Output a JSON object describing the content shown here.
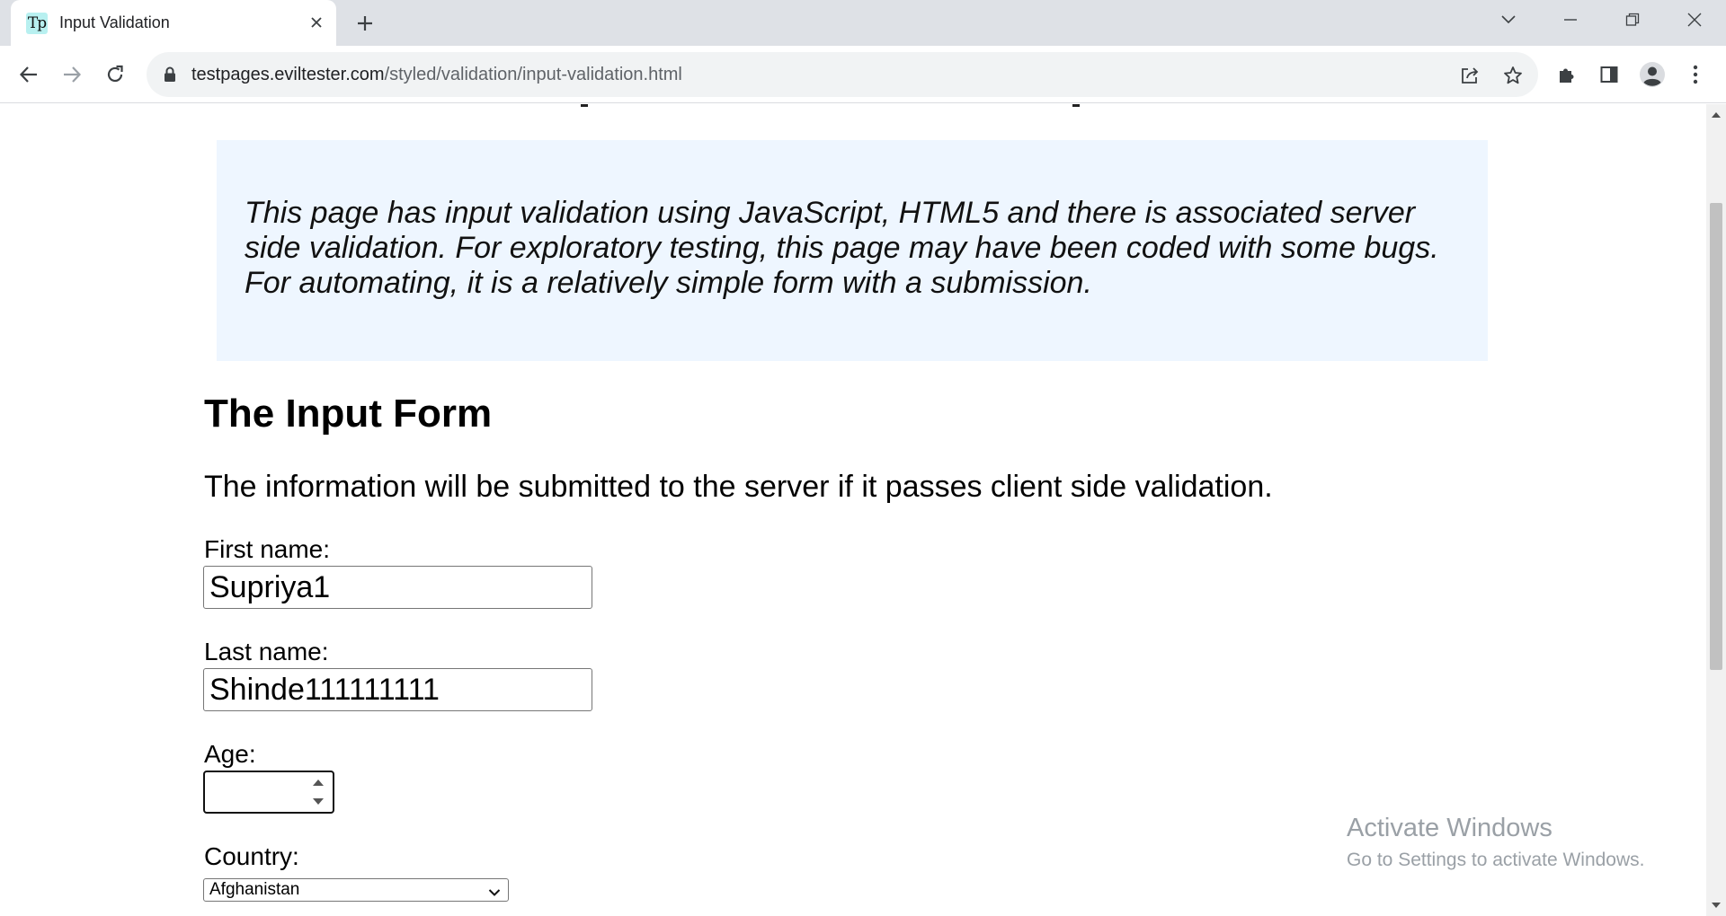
{
  "browser": {
    "tab": {
      "favicon_text": "Tp",
      "title": "Input Validation",
      "favicon_color": "#b8f0f0"
    },
    "address": {
      "host": "testpages.eviltester.com",
      "path": "/styled/validation/input-validation.html"
    },
    "icons": {
      "tab_close": "close-icon",
      "new_tab": "plus-icon",
      "tab_search": "chevron-down-icon",
      "minimize": "minimize-icon",
      "restore": "restore-icon",
      "close_window": "close-icon",
      "back": "back-arrow-icon",
      "forward": "forward-arrow-icon",
      "reload": "reload-icon",
      "lock": "lock-icon",
      "share": "share-icon",
      "bookmark": "star-icon",
      "extensions": "puzzle-icon",
      "side_panel": "side-panel-icon",
      "profile": "profile-icon",
      "menu": "kebab-menu-icon"
    }
  },
  "page": {
    "explanation": "This page has input validation using JavaScript, HTML5 and there is associated server side validation. For exploratory testing, this page may have been coded with some bugs. For automating, it is a relatively simple form with a submission.",
    "form_title": "The Input Form",
    "form_description": "The information will be submitted to the server if it passes client side validation.",
    "fields": {
      "first_name": {
        "label": "First name:",
        "value": "Supriya1"
      },
      "last_name": {
        "label": "Last name:",
        "value": "Shinde111111111"
      },
      "age": {
        "label": "Age:",
        "value": ""
      },
      "country": {
        "label": "Country:",
        "selected": "Afghanistan"
      }
    },
    "explanation_bg": "#eef6ff"
  },
  "watermark": {
    "title": "Activate Windows",
    "subtitle": "Go to Settings to activate Windows."
  }
}
